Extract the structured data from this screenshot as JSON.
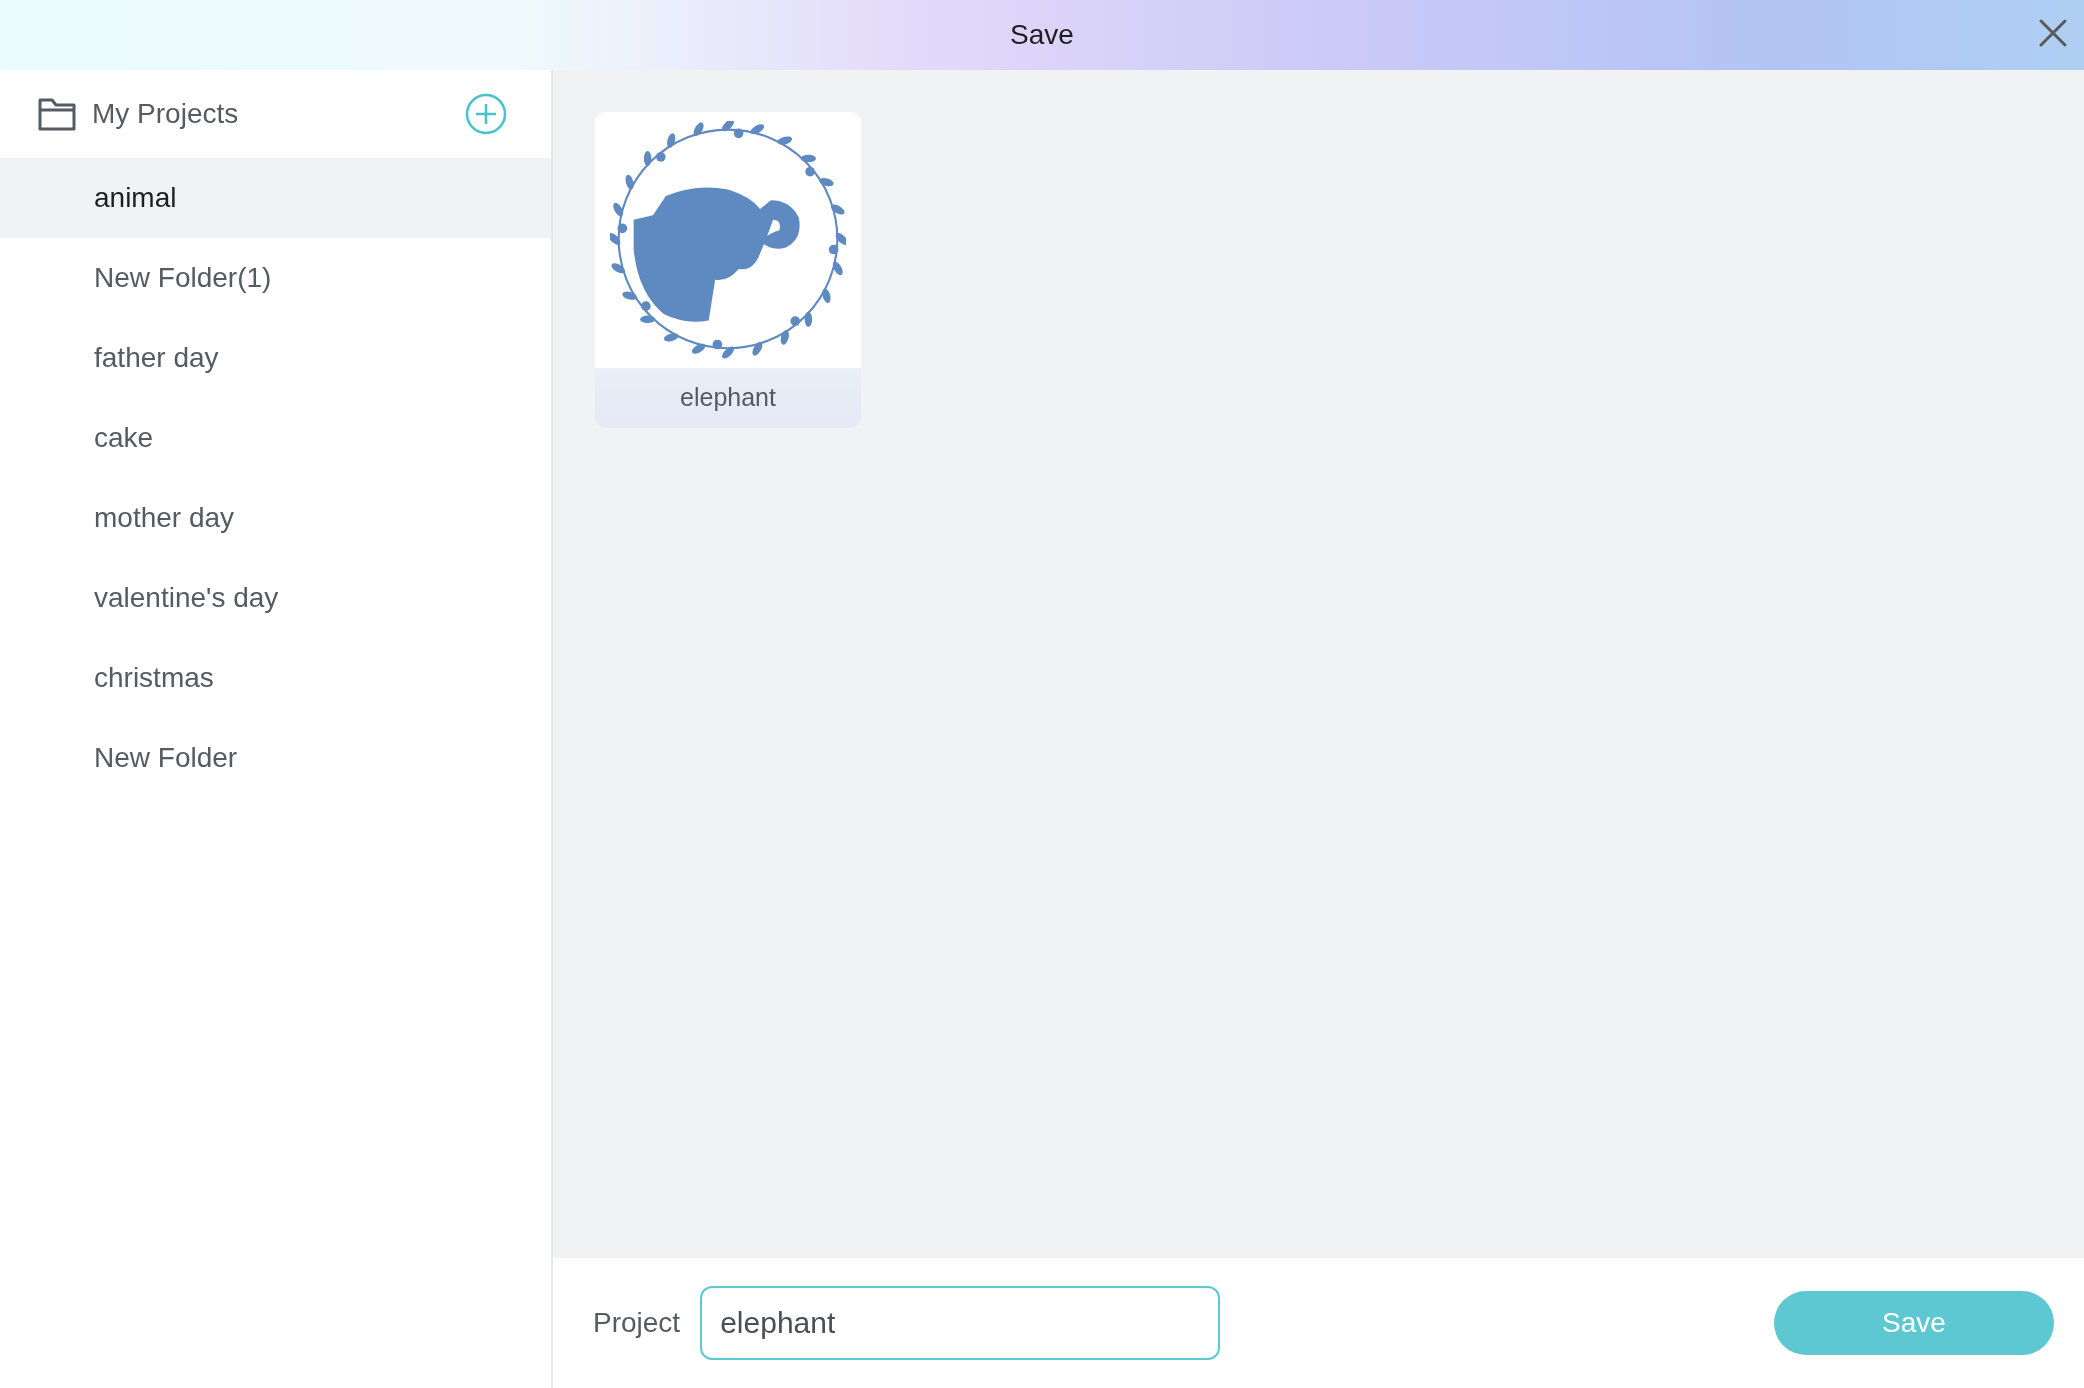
{
  "window": {
    "title": "Save"
  },
  "sidebar": {
    "title": "My Projects",
    "folders": [
      {
        "label": "animal",
        "selected": true
      },
      {
        "label": "New Folder(1)",
        "selected": false
      },
      {
        "label": "father day",
        "selected": false
      },
      {
        "label": "cake",
        "selected": false
      },
      {
        "label": "mother day",
        "selected": false
      },
      {
        "label": "valentine's day",
        "selected": false
      },
      {
        "label": "christmas",
        "selected": false
      },
      {
        "label": "New Folder",
        "selected": false
      }
    ]
  },
  "projects": [
    {
      "name": "elephant"
    }
  ],
  "footer": {
    "label": "Project",
    "value": "elephant",
    "button": "Save"
  }
}
